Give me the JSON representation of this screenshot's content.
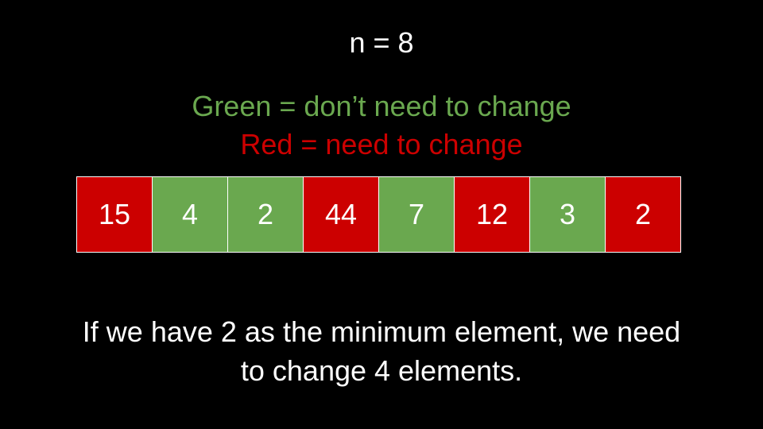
{
  "title": "n = 8",
  "legend": {
    "green_text": "Green = don’t need to change",
    "red_text": "Red = need to change",
    "green_color": "#6aa84f",
    "red_color": "#cc0000"
  },
  "array": [
    {
      "value": "15",
      "status": "red"
    },
    {
      "value": "4",
      "status": "green"
    },
    {
      "value": "2",
      "status": "green"
    },
    {
      "value": "44",
      "status": "red"
    },
    {
      "value": "7",
      "status": "green"
    },
    {
      "value": "12",
      "status": "red"
    },
    {
      "value": "3",
      "status": "green"
    },
    {
      "value": "2",
      "status": "red"
    }
  ],
  "caption": {
    "line1": "If we have 2 as the minimum element, we need",
    "line2": "to change 4 elements."
  }
}
